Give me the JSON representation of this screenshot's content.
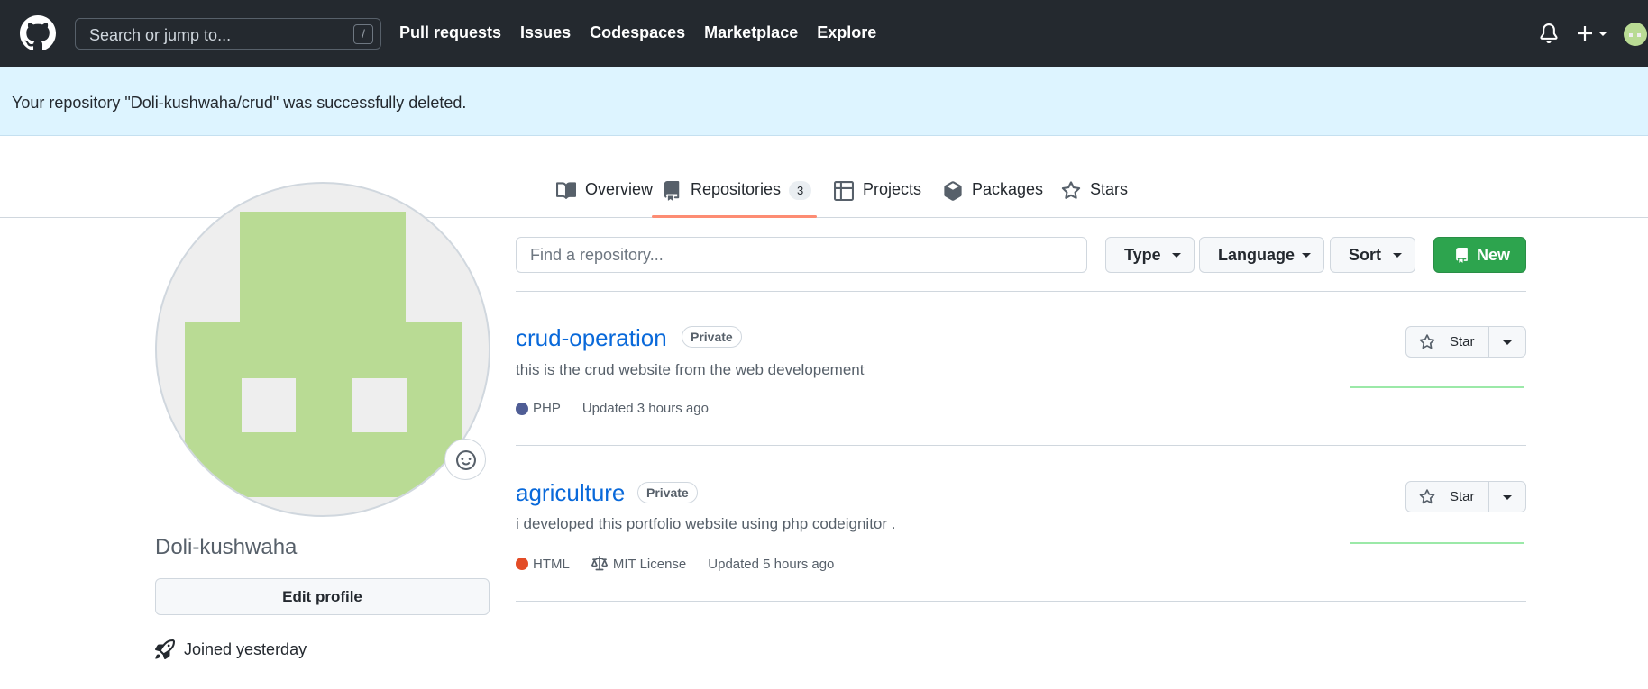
{
  "header": {
    "search_placeholder": "Search or jump to...",
    "search_shortcut": "/",
    "nav": [
      "Pull requests",
      "Issues",
      "Codespaces",
      "Marketplace",
      "Explore"
    ],
    "icons": [
      "github-logo-icon",
      "bell-icon",
      "plus-icon",
      "avatar"
    ]
  },
  "flash": {
    "message": "Your repository \"Doli-kushwaha/crud\" was successfully deleted."
  },
  "tabs": [
    {
      "label": "Overview",
      "icon": "book-icon"
    },
    {
      "label": "Repositories",
      "icon": "repo-icon",
      "count": "3",
      "selected": true
    },
    {
      "label": "Projects",
      "icon": "table-icon"
    },
    {
      "label": "Packages",
      "icon": "package-icon"
    },
    {
      "label": "Stars",
      "icon": "star-icon"
    }
  ],
  "profile": {
    "username": "Doli-kushwaha",
    "edit_label": "Edit profile",
    "joined": "Joined yesterday",
    "avatar_color": "#b9db94"
  },
  "controls": {
    "find_placeholder": "Find a repository...",
    "type_label": "Type",
    "language_label": "Language",
    "sort_label": "Sort",
    "new_label": "New",
    "accent": "#2da44e"
  },
  "repos": [
    {
      "name": "crud-operation",
      "visibility": "Private",
      "description": "this is the crud website from the web developement",
      "language": "PHP",
      "language_color": "#4F5D95",
      "updated": "Updated 3 hours ago",
      "star_label": "Star"
    },
    {
      "name": "agriculture",
      "visibility": "Private",
      "description": "i developed this portfolio website using php codeignitor .",
      "language": "HTML",
      "language_color": "#e34c26",
      "license": "MIT License",
      "updated": "Updated 5 hours ago",
      "star_label": "Star"
    }
  ]
}
